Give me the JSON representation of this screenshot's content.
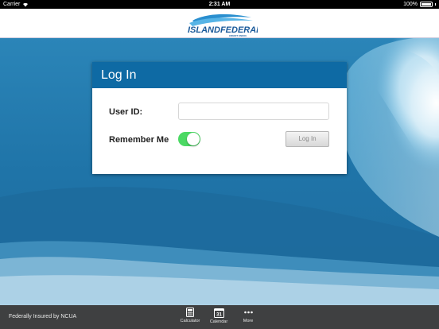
{
  "status_bar": {
    "carrier": "Carrier",
    "time": "2:31 AM",
    "battery": "100%"
  },
  "header": {
    "logo_main": "ISLANDFEDERAL",
    "logo_sub": "CREDIT UNION",
    "brand_color": "#1a5a9a"
  },
  "login": {
    "title": "Log In",
    "user_id_label": "User ID:",
    "user_id_value": "",
    "remember_label": "Remember Me",
    "remember_on": true,
    "button_label": "Log In"
  },
  "footer": {
    "ncua_text": "Federally Insured by NCUA",
    "tabs": [
      {
        "label": "Calculator",
        "icon": "calculator-icon"
      },
      {
        "label": "Calendar",
        "icon": "calendar-icon",
        "day": "31"
      },
      {
        "label": "More",
        "icon": "more-dots-icon"
      }
    ]
  },
  "colors": {
    "panel_header": "#0e6aa4",
    "toggle_on": "#4cd964",
    "bottom_bar": "#3f4041"
  }
}
